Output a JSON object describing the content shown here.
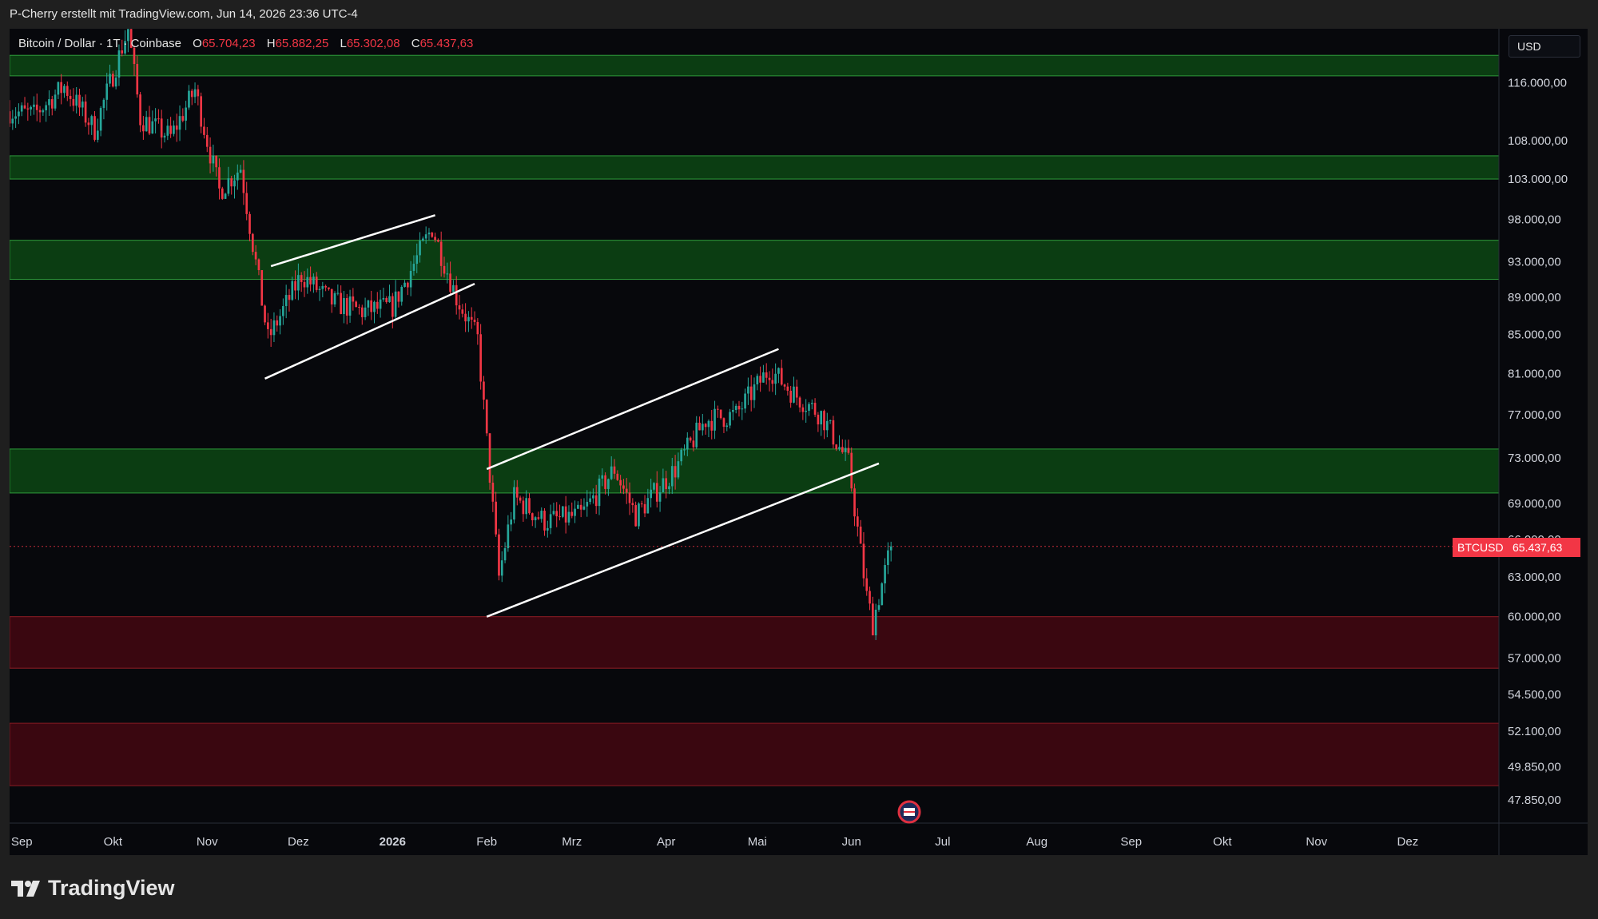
{
  "header": {
    "attribution": "P-Cherry erstellt mit TradingView.com, Jun 14, 2026 23:36 UTC-4"
  },
  "legend": {
    "symbol": "Bitcoin / Dollar · 1T · Coinbase",
    "open_label": "O",
    "open": "65.704,23",
    "high_label": "H",
    "high": "65.882,25",
    "low_label": "L",
    "low": "65.302,08",
    "close_label": "C",
    "close": "65.437,63"
  },
  "price_axis": {
    "currency": "USD"
  },
  "current_price": {
    "symbol": "BTCUSD",
    "value": "65.437,63"
  },
  "brand": {
    "name": "TradingView"
  },
  "colors": {
    "up": "#26a69a",
    "down": "#f23645",
    "zone_support": "#0b3d12",
    "zone_support_border": "#2e9b3b",
    "zone_resistance": "#3a0710",
    "zone_resistance_border": "#8e1d24",
    "trendline": "#ffffff",
    "background": "#07080c"
  },
  "chart_data": {
    "type": "candlestick",
    "x_ticks": [
      "Sep",
      "Okt",
      "Nov",
      "Dez",
      "2026",
      "Feb",
      "Mrz",
      "Apr",
      "Mai",
      "Jun",
      "Jul",
      "Aug",
      "Sep",
      "Okt",
      "Nov",
      "Dez"
    ],
    "y_ticks": [
      {
        "value": 116000,
        "label": "116.000,00"
      },
      {
        "value": 108000,
        "label": "108.000,00"
      },
      {
        "value": 103000,
        "label": "103.000,00"
      },
      {
        "value": 98000,
        "label": "98.000,00"
      },
      {
        "value": 93000,
        "label": "93.000,00"
      },
      {
        "value": 89000,
        "label": "89.000,00"
      },
      {
        "value": 85000,
        "label": "85.000,00"
      },
      {
        "value": 81000,
        "label": "81.000,00"
      },
      {
        "value": 77000,
        "label": "77.000,00"
      },
      {
        "value": 73000,
        "label": "73.000,00"
      },
      {
        "value": 69000,
        "label": "69.000,00"
      },
      {
        "value": 66000,
        "label": "66.000,00"
      },
      {
        "value": 63000,
        "label": "63.000,00"
      },
      {
        "value": 60000,
        "label": "60.000,00"
      },
      {
        "value": 57000,
        "label": "57.000,00"
      },
      {
        "value": 54500,
        "label": "54.500,00"
      },
      {
        "value": 52100,
        "label": "52.100,00"
      },
      {
        "value": 49850,
        "label": "49.850,00"
      },
      {
        "value": 47850,
        "label": "47.850,00"
      }
    ],
    "y_scale": "log",
    "y_range": [
      46500,
      124000
    ],
    "x_range": [
      "2025-08-28",
      "2026-12-31"
    ],
    "last_price": 65437.63,
    "zones": [
      {
        "kind": "support",
        "low": 117000,
        "high": 120000
      },
      {
        "kind": "support",
        "low": 103000,
        "high": 106000
      },
      {
        "kind": "support",
        "low": 91000,
        "high": 95500
      },
      {
        "kind": "support",
        "low": 69900,
        "high": 73800
      },
      {
        "kind": "resistance",
        "low": 56300,
        "high": 60000
      },
      {
        "kind": "resistance",
        "low": 48700,
        "high": 52600
      }
    ],
    "trendlines": [
      {
        "from": [
          "2025-11-22",
          92500
        ],
        "to": [
          "2026-01-15",
          98500
        ]
      },
      {
        "from": [
          "2025-11-20",
          80500
        ],
        "to": [
          "2026-01-28",
          90500
        ]
      },
      {
        "from": [
          "2026-02-01",
          72000
        ],
        "to": [
          "2026-05-08",
          83500
        ]
      },
      {
        "from": [
          "2026-02-01",
          60000
        ],
        "to": [
          "2026-06-10",
          72500
        ]
      }
    ],
    "price_path": [
      [
        "2025-08-28",
        112000
      ],
      [
        "2025-09-05",
        111500
      ],
      [
        "2025-09-15",
        115500
      ],
      [
        "2025-09-25",
        109500
      ],
      [
        "2025-10-06",
        124000
      ],
      [
        "2025-10-10",
        111000
      ],
      [
        "2025-10-20",
        108500
      ],
      [
        "2025-10-28",
        115000
      ],
      [
        "2025-11-05",
        101500
      ],
      [
        "2025-11-12",
        104500
      ],
      [
        "2025-11-21",
        84500
      ],
      [
        "2025-12-02",
        91500
      ],
      [
        "2025-12-12",
        88500
      ],
      [
        "2025-12-22",
        87500
      ],
      [
        "2026-01-01",
        88000
      ],
      [
        "2026-01-14",
        97000
      ],
      [
        "2026-01-22",
        89000
      ],
      [
        "2026-01-29",
        84500
      ],
      [
        "2026-02-05",
        63000
      ],
      [
        "2026-02-10",
        69500
      ],
      [
        "2026-02-20",
        67500
      ],
      [
        "2026-03-04",
        68000
      ],
      [
        "2026-03-15",
        72000
      ],
      [
        "2026-03-22",
        68000
      ],
      [
        "2026-04-04",
        72000
      ],
      [
        "2026-04-14",
        76500
      ],
      [
        "2026-04-24",
        77000
      ],
      [
        "2026-05-05",
        81500
      ],
      [
        "2026-05-13",
        79000
      ],
      [
        "2026-05-22",
        77000
      ],
      [
        "2026-05-31",
        72500
      ],
      [
        "2026-06-06",
        61500
      ],
      [
        "2026-06-08",
        59500
      ],
      [
        "2026-06-10",
        61500
      ],
      [
        "2026-06-14",
        65437.63
      ]
    ]
  }
}
